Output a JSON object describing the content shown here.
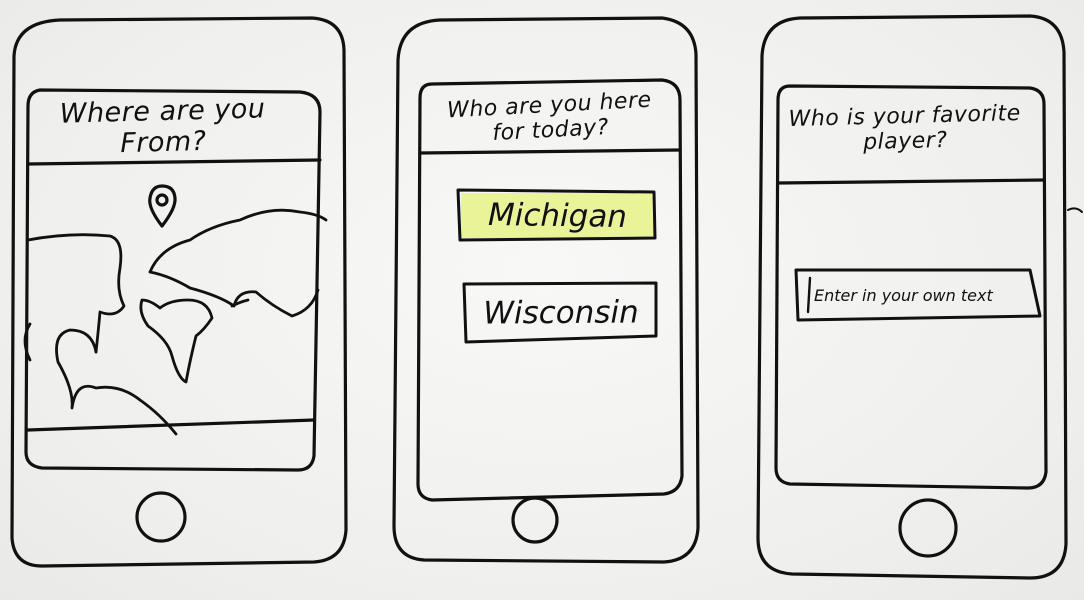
{
  "screens": [
    {
      "title": "Where are you From?",
      "content": "world-map"
    },
    {
      "title": "Who are you here for today?",
      "options": [
        "Michigan",
        "Wisconsin"
      ]
    },
    {
      "title": "Who is your favorite player?",
      "input_placeholder": "Enter in your own text"
    }
  ],
  "colors": {
    "ink": "#111111",
    "highlight": "#e7f27a",
    "paper": "#f3f3f1"
  }
}
